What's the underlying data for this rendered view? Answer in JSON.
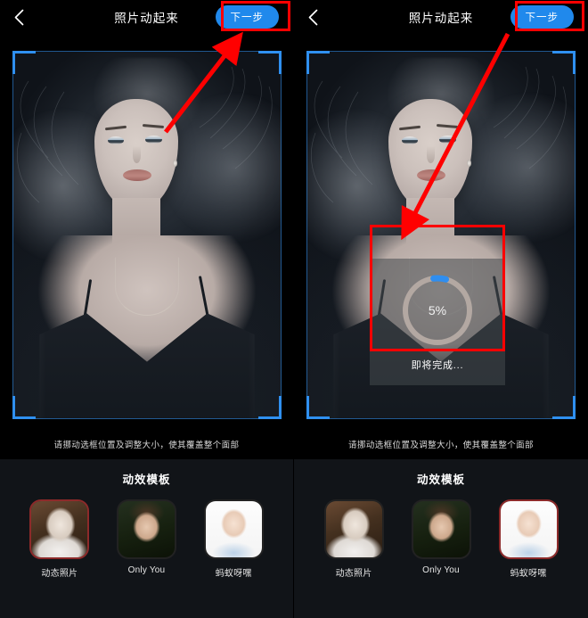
{
  "app": {
    "accent_blue": "#2089ec",
    "annotation_red": "#ff0000",
    "crop_bracket_blue": "#2f90f0",
    "selected_thumb_border": "#8d2a2a",
    "tray_background": "#111418"
  },
  "panels": [
    {
      "id": "step-select-face",
      "header": {
        "back_icon": "chevron-left-icon",
        "title": "照片动起来",
        "next_label": "下一步"
      },
      "stage": {
        "hint": "请挪动选框位置及调整大小，使其覆盖整个面部",
        "crop_frame": "face-crop-frame"
      },
      "tray": {
        "title": "动效模板",
        "items": [
          {
            "label": "动态照片",
            "selected": true
          },
          {
            "label": "Only You",
            "selected": false
          },
          {
            "label": "蚂蚁呀嘿",
            "selected": false
          }
        ]
      },
      "annotations": {
        "highlight_target": "next-button",
        "arrow": "arrow-to-next-button"
      },
      "progress": null
    },
    {
      "id": "step-generating",
      "header": {
        "back_icon": "chevron-left-icon",
        "title": "照片动起来",
        "next_label": "下一步"
      },
      "stage": {
        "hint": "请挪动选框位置及调整大小，使其覆盖整个面部",
        "crop_frame": "face-crop-frame"
      },
      "tray": {
        "title": "动效模板",
        "items": [
          {
            "label": "动态照片",
            "selected": false
          },
          {
            "label": "Only You",
            "selected": false
          },
          {
            "label": "蚂蚁呀嘿",
            "selected": true
          }
        ]
      },
      "annotations": {
        "highlight_target": "progress-dialog",
        "arrow": "arrow-from-next-button-to-progress"
      },
      "progress": {
        "percent_label": "5%",
        "percent_value": 5,
        "status_text": "即将完成..."
      }
    }
  ]
}
